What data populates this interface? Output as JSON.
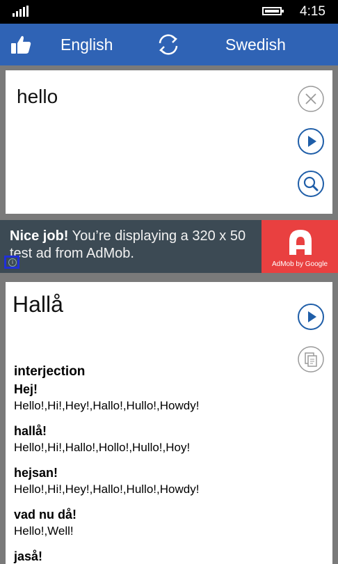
{
  "status": {
    "time": "4:15"
  },
  "header": {
    "source_language": "English",
    "target_language": "Swedish"
  },
  "input": {
    "text": "hello"
  },
  "ad": {
    "bold": "Nice job!",
    "text": " You’re displaying a 320 x 50 test ad from AdMob.",
    "brand": "AdMob by Google"
  },
  "result": {
    "translation": "Hallå",
    "part_of_speech": "interjection",
    "entries": [
      {
        "word": "Hej!",
        "synonyms": "Hello!,Hi!,Hey!,Hallo!,Hullo!,Howdy!"
      },
      {
        "word": "hallå!",
        "synonyms": "Hello!,Hi!,Hallo!,Hollo!,Hullo!,Hoy!"
      },
      {
        "word": "hejsan!",
        "synonyms": "Hello!,Hi!,Hey!,Hallo!,Hullo!,Howdy!"
      },
      {
        "word": "vad nu då!",
        "synonyms": "Hello!,Well!"
      },
      {
        "word": "jaså!",
        "synonyms": ""
      }
    ]
  },
  "colors": {
    "header": "#2f63b5",
    "accent": "#1f5ea8",
    "ad_bg": "#3c4a54",
    "ad_logo": "#e94040"
  }
}
